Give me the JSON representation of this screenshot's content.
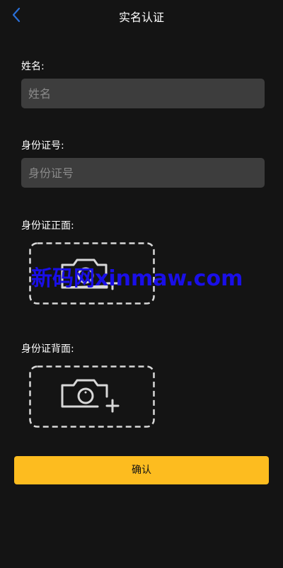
{
  "header": {
    "title": "实名认证",
    "back_icon": "chevron-left-icon"
  },
  "form": {
    "name": {
      "label": "姓名:",
      "placeholder": "姓名",
      "value": ""
    },
    "id_number": {
      "label": "身份证号:",
      "placeholder": "身份证号",
      "value": ""
    },
    "id_front": {
      "label": "身份证正面:",
      "icon": "camera-add-icon"
    },
    "id_back": {
      "label": "身份证背面:",
      "icon": "camera-add-icon"
    }
  },
  "watermark": "新码网xinmaw.com",
  "confirm_label": "确认",
  "colors": {
    "background": "#141414",
    "input_background": "#3d3d3d",
    "accent": "#fdbc1f",
    "back_icon": "#2a6fd6",
    "watermark": "#1a0fe8"
  }
}
